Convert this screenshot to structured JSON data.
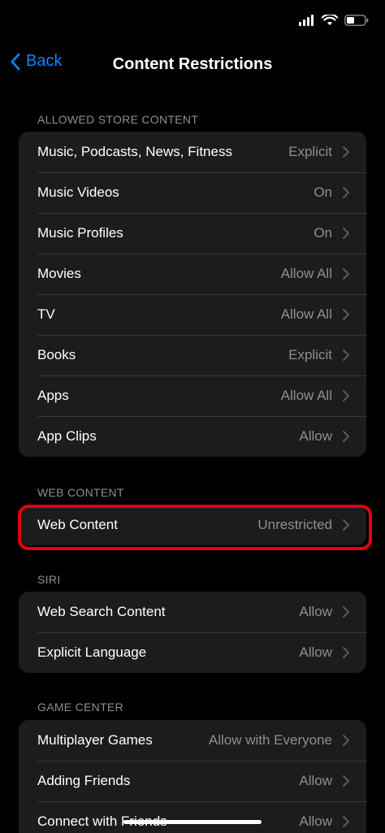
{
  "nav": {
    "back_label": "Back",
    "title": "Content Restrictions"
  },
  "colors": {
    "accent": "#0a84ff",
    "highlight": "#e3000f",
    "background": "#000000",
    "group_background": "#1c1c1e",
    "secondary_text": "#8e8e93"
  },
  "sections": {
    "store": {
      "header": "ALLOWED STORE CONTENT",
      "rows": [
        {
          "label": "Music, Podcasts, News, Fitness",
          "value": "Explicit"
        },
        {
          "label": "Music Videos",
          "value": "On"
        },
        {
          "label": "Music Profiles",
          "value": "On"
        },
        {
          "label": "Movies",
          "value": "Allow All"
        },
        {
          "label": "TV",
          "value": "Allow All"
        },
        {
          "label": "Books",
          "value": "Explicit"
        },
        {
          "label": "Apps",
          "value": "Allow All"
        },
        {
          "label": "App Clips",
          "value": "Allow"
        }
      ]
    },
    "web": {
      "header": "WEB CONTENT",
      "rows": [
        {
          "label": "Web Content",
          "value": "Unrestricted"
        }
      ]
    },
    "siri": {
      "header": "SIRI",
      "rows": [
        {
          "label": "Web Search Content",
          "value": "Allow"
        },
        {
          "label": "Explicit Language",
          "value": "Allow"
        }
      ]
    },
    "game_center": {
      "header": "GAME CENTER",
      "rows": [
        {
          "label": "Multiplayer Games",
          "value": "Allow with Everyone"
        },
        {
          "label": "Adding Friends",
          "value": "Allow"
        },
        {
          "label": "Connect with Friends",
          "value": "Allow"
        }
      ]
    }
  }
}
